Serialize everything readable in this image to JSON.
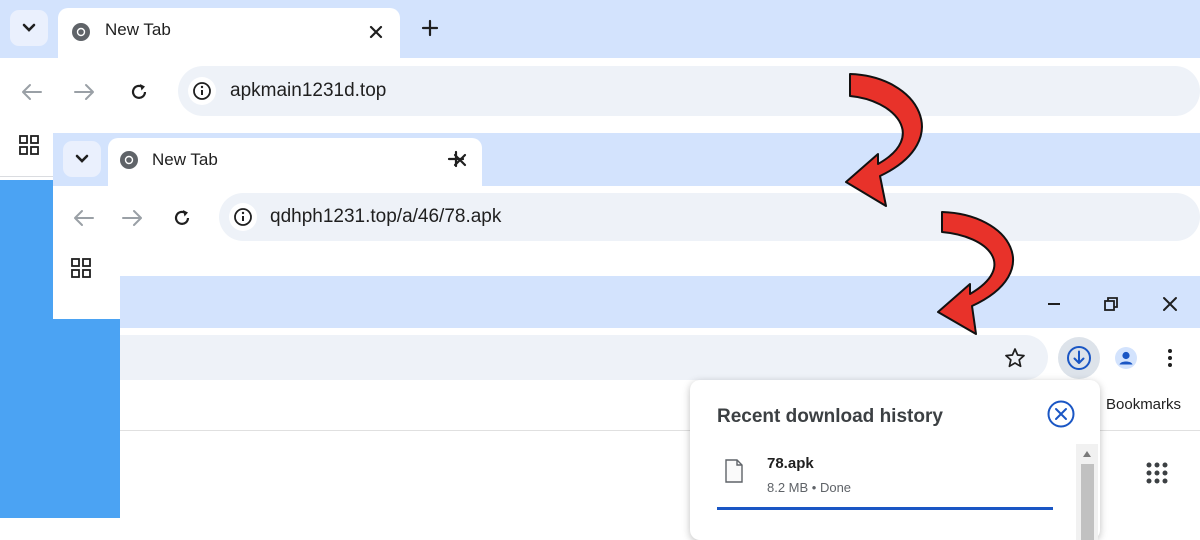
{
  "window1": {
    "tab_title": "New Tab",
    "url": "apkmain1231d.top"
  },
  "window2": {
    "tab_title": "New Tab",
    "url": "qdhph1231.top/a/46/78.apk"
  },
  "window3": {
    "bookmarks_label": "Bookmarks",
    "download_panel": {
      "title": "Recent download history",
      "items": [
        {
          "filename": "78.apk",
          "status": "8.2 MB • Done"
        }
      ]
    }
  },
  "colors": {
    "tabstrip": "#d3e3fd",
    "omnibox": "#eef2f8",
    "accent": "#1a56c4",
    "arrow": "#e8322a",
    "side_blue": "#4ba3f3"
  }
}
